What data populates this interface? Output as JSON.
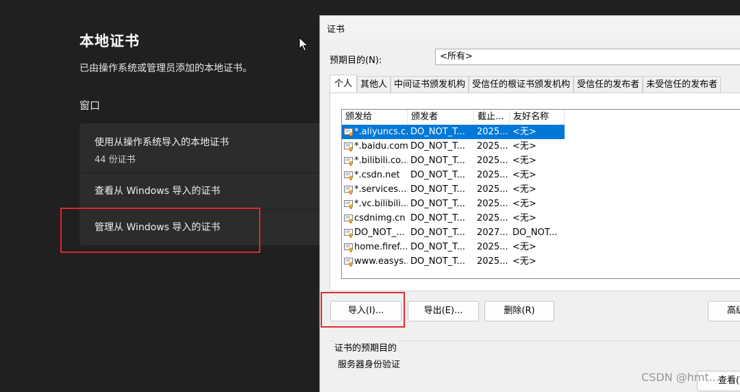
{
  "settings": {
    "title": "本地证书",
    "description": "已由操作系统或管理员添加的本地证书。",
    "section_label": "窗口",
    "cards": [
      {
        "label": "使用从操作系统导入的本地证书",
        "sub": "44 份证书"
      },
      {
        "label": "查看从 Windows 导入的证书"
      },
      {
        "label": "管理从 Windows 导入的证书"
      }
    ]
  },
  "dialog": {
    "title": "证书",
    "purpose_label": "预期目的(N):",
    "purpose_value": "<所有>",
    "tabs": [
      "个人",
      "其他人",
      "中间证书颁发机构",
      "受信任的根证书颁发机构",
      "受信任的发布者",
      "未受信任的发布者"
    ],
    "columns": [
      "颁发给",
      "颁发者",
      "截止...",
      "友好名称"
    ],
    "rows": [
      {
        "issued_to": "*.aliyuncs.c...",
        "issuer": "DO_NOT_T...",
        "expires": "2025...",
        "friendly": "<无>",
        "selected": true
      },
      {
        "issued_to": "*.baidu.com",
        "issuer": "DO_NOT_T...",
        "expires": "2025...",
        "friendly": "<无>"
      },
      {
        "issued_to": "*.bilibili.co...",
        "issuer": "DO_NOT_T...",
        "expires": "2025...",
        "friendly": "<无>"
      },
      {
        "issued_to": "*.csdn.net",
        "issuer": "DO_NOT_T...",
        "expires": "2025...",
        "friendly": "<无>"
      },
      {
        "issued_to": "*.services....",
        "issuer": "DO_NOT_T...",
        "expires": "2025...",
        "friendly": "<无>"
      },
      {
        "issued_to": "*.vc.bilibili...",
        "issuer": "DO_NOT_T...",
        "expires": "2025...",
        "friendly": "<无>"
      },
      {
        "issued_to": "csdnimg.cn",
        "issuer": "DO_NOT_T...",
        "expires": "2025...",
        "friendly": "<无>"
      },
      {
        "issued_to": "DO_NOT_...",
        "issuer": "DO_NOT_T...",
        "expires": "2027...",
        "friendly": "DO_NOT..."
      },
      {
        "issued_to": "home.firef...",
        "issuer": "DO_NOT_T...",
        "expires": "2025...",
        "friendly": "<无>"
      },
      {
        "issued_to": "www.easys...",
        "issuer": "DO_NOT_T...",
        "expires": "2025...",
        "friendly": "<无>"
      }
    ],
    "buttons": {
      "import": "导入(I)...",
      "export": "导出(E)...",
      "delete": "删除(R)",
      "advanced": "高级",
      "view": "查看(V)"
    },
    "purpose_group_title": "证书的预期目的",
    "purpose_group_value": "服务器身份验证"
  },
  "watermark": "CSDN @hmt..."
}
